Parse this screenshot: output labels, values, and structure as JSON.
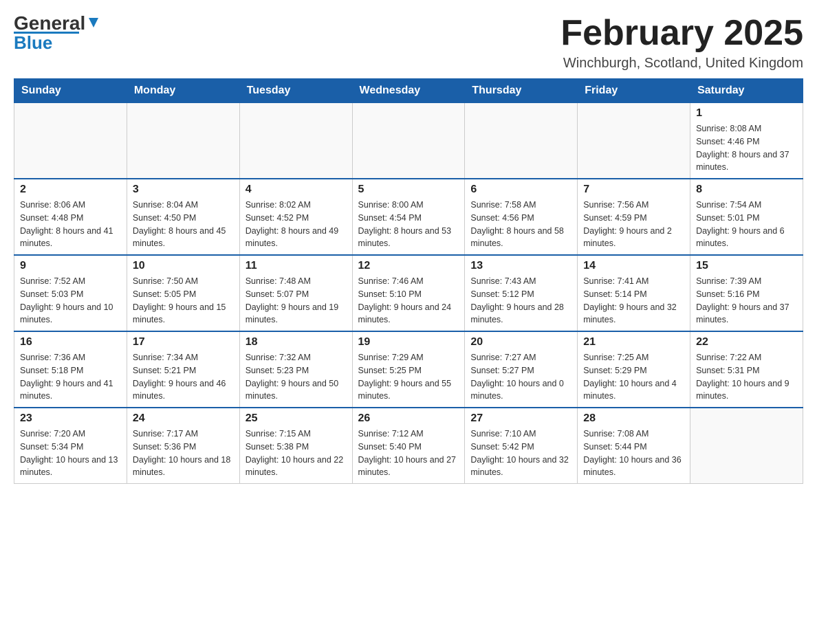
{
  "header": {
    "logo_text_general": "General",
    "logo_text_blue": "Blue",
    "month_title": "February 2025",
    "location": "Winchburgh, Scotland, United Kingdom"
  },
  "weekdays": [
    "Sunday",
    "Monday",
    "Tuesday",
    "Wednesday",
    "Thursday",
    "Friday",
    "Saturday"
  ],
  "weeks": [
    [
      {
        "day": "",
        "info": ""
      },
      {
        "day": "",
        "info": ""
      },
      {
        "day": "",
        "info": ""
      },
      {
        "day": "",
        "info": ""
      },
      {
        "day": "",
        "info": ""
      },
      {
        "day": "",
        "info": ""
      },
      {
        "day": "1",
        "info": "Sunrise: 8:08 AM\nSunset: 4:46 PM\nDaylight: 8 hours and 37 minutes."
      }
    ],
    [
      {
        "day": "2",
        "info": "Sunrise: 8:06 AM\nSunset: 4:48 PM\nDaylight: 8 hours and 41 minutes."
      },
      {
        "day": "3",
        "info": "Sunrise: 8:04 AM\nSunset: 4:50 PM\nDaylight: 8 hours and 45 minutes."
      },
      {
        "day": "4",
        "info": "Sunrise: 8:02 AM\nSunset: 4:52 PM\nDaylight: 8 hours and 49 minutes."
      },
      {
        "day": "5",
        "info": "Sunrise: 8:00 AM\nSunset: 4:54 PM\nDaylight: 8 hours and 53 minutes."
      },
      {
        "day": "6",
        "info": "Sunrise: 7:58 AM\nSunset: 4:56 PM\nDaylight: 8 hours and 58 minutes."
      },
      {
        "day": "7",
        "info": "Sunrise: 7:56 AM\nSunset: 4:59 PM\nDaylight: 9 hours and 2 minutes."
      },
      {
        "day": "8",
        "info": "Sunrise: 7:54 AM\nSunset: 5:01 PM\nDaylight: 9 hours and 6 minutes."
      }
    ],
    [
      {
        "day": "9",
        "info": "Sunrise: 7:52 AM\nSunset: 5:03 PM\nDaylight: 9 hours and 10 minutes."
      },
      {
        "day": "10",
        "info": "Sunrise: 7:50 AM\nSunset: 5:05 PM\nDaylight: 9 hours and 15 minutes."
      },
      {
        "day": "11",
        "info": "Sunrise: 7:48 AM\nSunset: 5:07 PM\nDaylight: 9 hours and 19 minutes."
      },
      {
        "day": "12",
        "info": "Sunrise: 7:46 AM\nSunset: 5:10 PM\nDaylight: 9 hours and 24 minutes."
      },
      {
        "day": "13",
        "info": "Sunrise: 7:43 AM\nSunset: 5:12 PM\nDaylight: 9 hours and 28 minutes."
      },
      {
        "day": "14",
        "info": "Sunrise: 7:41 AM\nSunset: 5:14 PM\nDaylight: 9 hours and 32 minutes."
      },
      {
        "day": "15",
        "info": "Sunrise: 7:39 AM\nSunset: 5:16 PM\nDaylight: 9 hours and 37 minutes."
      }
    ],
    [
      {
        "day": "16",
        "info": "Sunrise: 7:36 AM\nSunset: 5:18 PM\nDaylight: 9 hours and 41 minutes."
      },
      {
        "day": "17",
        "info": "Sunrise: 7:34 AM\nSunset: 5:21 PM\nDaylight: 9 hours and 46 minutes."
      },
      {
        "day": "18",
        "info": "Sunrise: 7:32 AM\nSunset: 5:23 PM\nDaylight: 9 hours and 50 minutes."
      },
      {
        "day": "19",
        "info": "Sunrise: 7:29 AM\nSunset: 5:25 PM\nDaylight: 9 hours and 55 minutes."
      },
      {
        "day": "20",
        "info": "Sunrise: 7:27 AM\nSunset: 5:27 PM\nDaylight: 10 hours and 0 minutes."
      },
      {
        "day": "21",
        "info": "Sunrise: 7:25 AM\nSunset: 5:29 PM\nDaylight: 10 hours and 4 minutes."
      },
      {
        "day": "22",
        "info": "Sunrise: 7:22 AM\nSunset: 5:31 PM\nDaylight: 10 hours and 9 minutes."
      }
    ],
    [
      {
        "day": "23",
        "info": "Sunrise: 7:20 AM\nSunset: 5:34 PM\nDaylight: 10 hours and 13 minutes."
      },
      {
        "day": "24",
        "info": "Sunrise: 7:17 AM\nSunset: 5:36 PM\nDaylight: 10 hours and 18 minutes."
      },
      {
        "day": "25",
        "info": "Sunrise: 7:15 AM\nSunset: 5:38 PM\nDaylight: 10 hours and 22 minutes."
      },
      {
        "day": "26",
        "info": "Sunrise: 7:12 AM\nSunset: 5:40 PM\nDaylight: 10 hours and 27 minutes."
      },
      {
        "day": "27",
        "info": "Sunrise: 7:10 AM\nSunset: 5:42 PM\nDaylight: 10 hours and 32 minutes."
      },
      {
        "day": "28",
        "info": "Sunrise: 7:08 AM\nSunset: 5:44 PM\nDaylight: 10 hours and 36 minutes."
      },
      {
        "day": "",
        "info": ""
      }
    ]
  ]
}
